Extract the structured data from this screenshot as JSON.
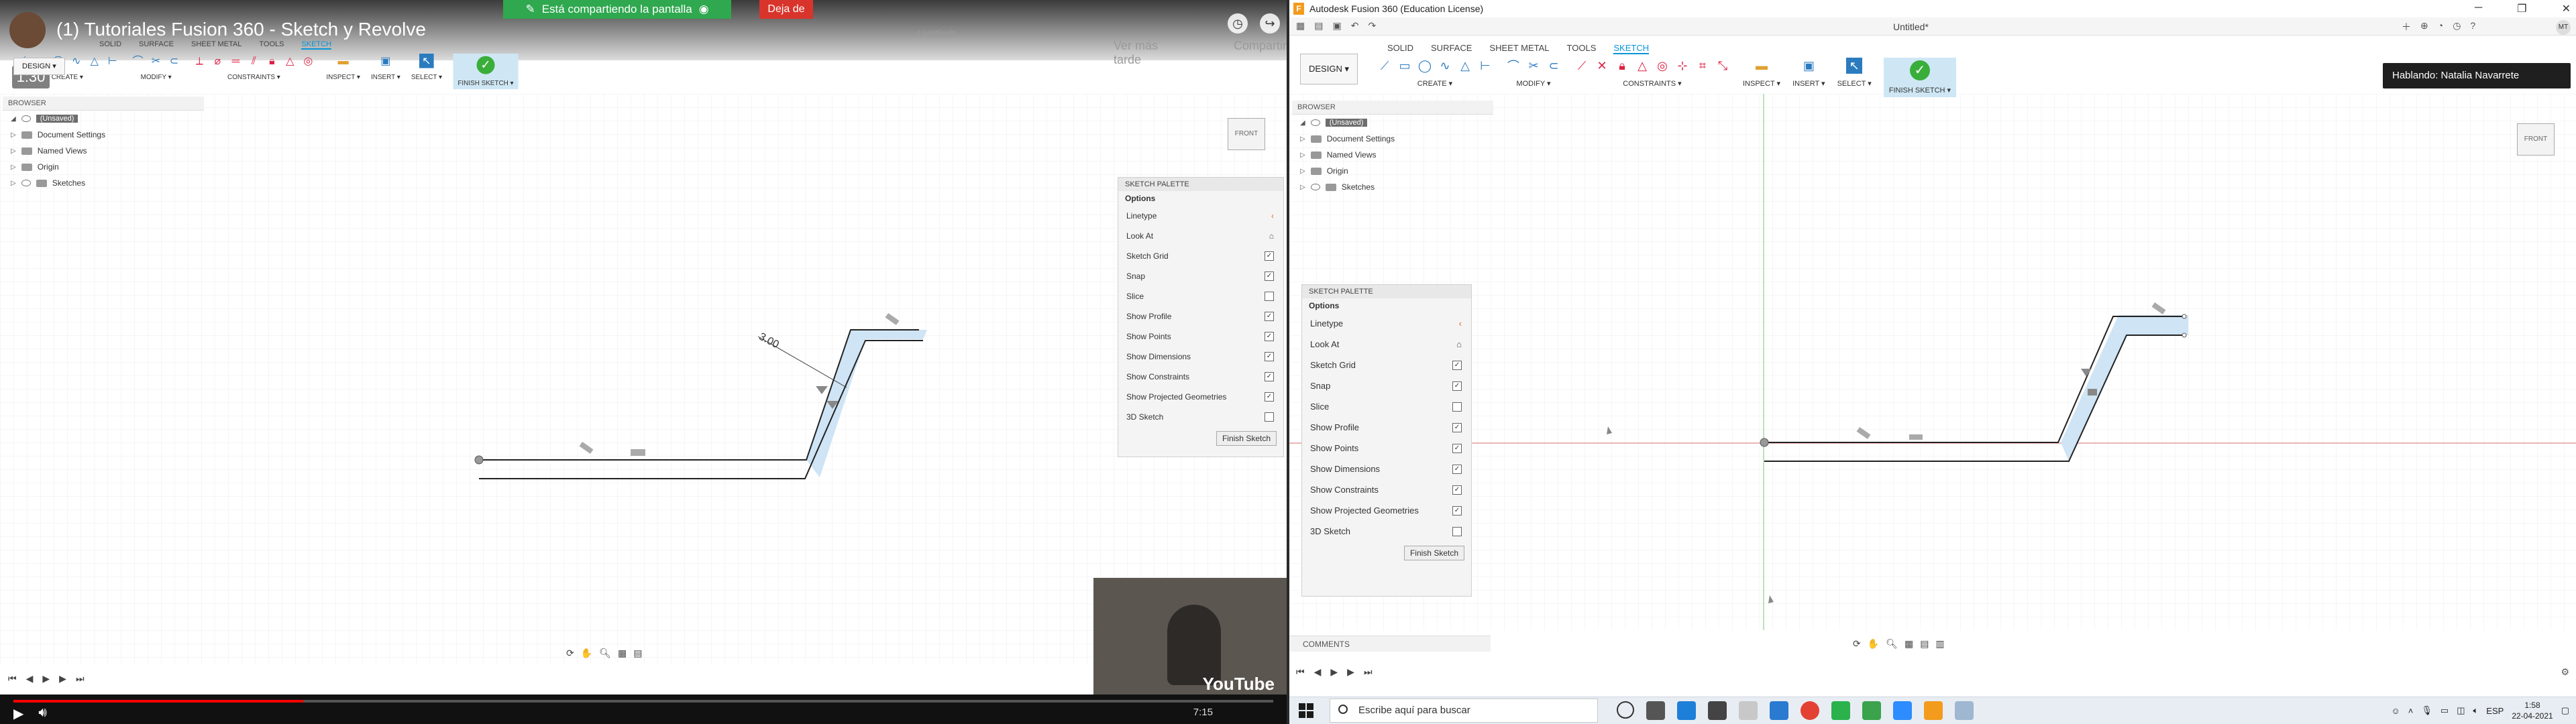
{
  "left": {
    "share_banner": "Está compartiendo la pantalla",
    "share_stop": "Deja de",
    "video_title": "(1) Tutoriales Fusion 360 - Sketch y Revolve",
    "timecode": "1:30",
    "window_title_faint": "Autodesk Fusion 360 (Education License)",
    "tab_top": "Untitled*",
    "tabs": [
      "SOLID",
      "SURFACE",
      "SHEET METAL",
      "TOOLS",
      "SKETCH"
    ],
    "design_label": "DESIGN ▾",
    "groups": [
      "CREATE ▾",
      "MODIFY ▾",
      "CONSTRAINTS ▾",
      "INSPECT ▾",
      "INSERT ▾",
      "SELECT ▾",
      "FINISH SKETCH ▾"
    ],
    "overlay_right": [
      "Ver más tarde",
      "Compartir"
    ],
    "browser_header": "BROWSER",
    "browser_items": [
      "(Unsaved)",
      "Document Settings",
      "Named Views",
      "Origin",
      "Sketches"
    ],
    "dimension_label": "3.00",
    "video_time": "7:15",
    "youtube_logo": "YouTube"
  },
  "right": {
    "window_title": "Autodesk Fusion 360 (Education License)",
    "doc_title": "Untitled*",
    "user_initials": "MT",
    "tabs": [
      "SOLID",
      "SURFACE",
      "SHEET METAL",
      "TOOLS",
      "SKETCH"
    ],
    "design_label": "DESIGN ▾",
    "groups": [
      "CREATE ▾",
      "MODIFY ▾",
      "CONSTRAINTS ▾",
      "INSPECT ▾",
      "INSERT ▾",
      "SELECT ▾",
      "FINISH SKETCH ▾"
    ],
    "toast": "Hablando: Natalia Navarrete",
    "browser_header": "BROWSER",
    "browser_items": [
      "(Unsaved)",
      "Document Settings",
      "Named Views",
      "Origin",
      "Sketches"
    ],
    "comments": "COMMENTS",
    "viewcube_label": "FRONT"
  },
  "palette": {
    "title": "SKETCH PALETTE",
    "section": "Options",
    "rows": [
      {
        "label": "Linetype",
        "kind": "icon"
      },
      {
        "label": "Look At",
        "kind": "icon"
      },
      {
        "label": "Sketch Grid",
        "checked": true
      },
      {
        "label": "Snap",
        "checked": true
      },
      {
        "label": "Slice",
        "checked": false
      },
      {
        "label": "Show Profile",
        "checked": true
      },
      {
        "label": "Show Points",
        "checked": true
      },
      {
        "label": "Show Dimensions",
        "checked": true
      },
      {
        "label": "Show Constraints",
        "checked": true
      },
      {
        "label": "Show Projected Geometries",
        "checked": true
      },
      {
        "label": "3D Sketch",
        "checked": false
      }
    ],
    "finish_button": "Finish Sketch"
  },
  "taskbar": {
    "search_placeholder": "Escribe aquí para buscar",
    "language": "ESP",
    "time": "1:58",
    "date": "22-04-2021"
  },
  "colors": {
    "accent": "#0696d7",
    "finish_green": "#3aae3a",
    "share_green": "#2fa84f",
    "stop_red": "#d9342b",
    "profile_fill": "#cfe4f5",
    "axis_red": "#e35b5b",
    "axis_green": "#6cc46c"
  }
}
